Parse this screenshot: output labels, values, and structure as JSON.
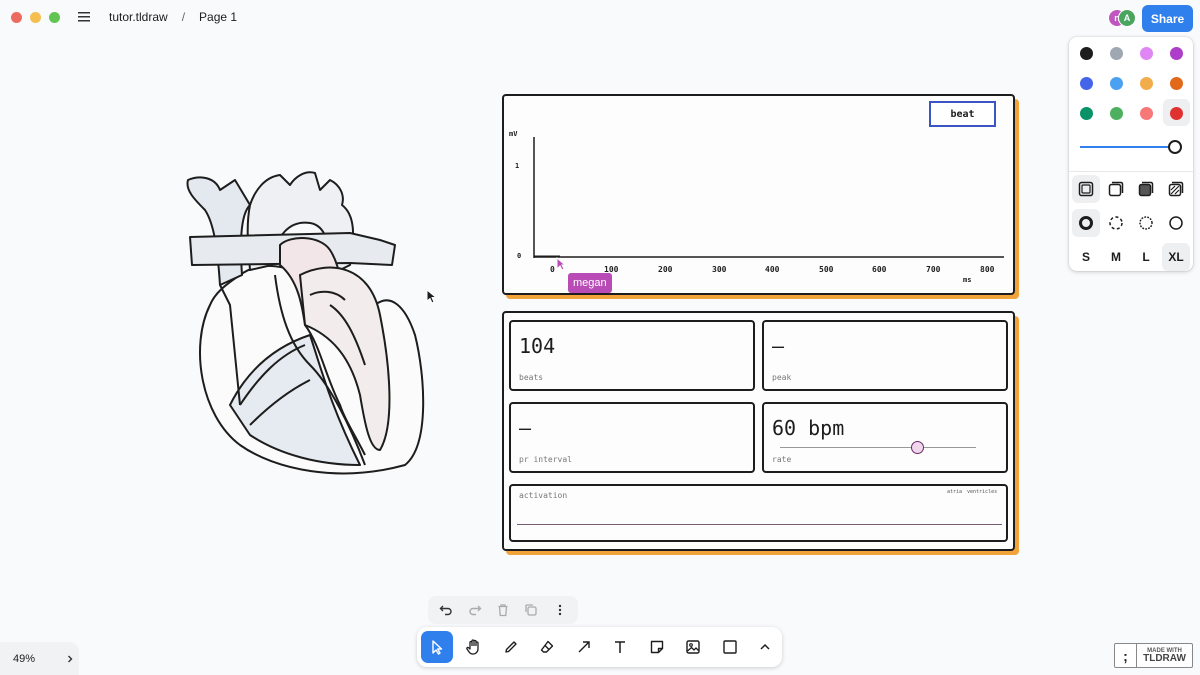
{
  "window": {
    "colors": {
      "close": "#ed6a5e",
      "minimize": "#f5bf4f",
      "maximize": "#61c554"
    }
  },
  "header": {
    "app_file": "tutor.tldraw",
    "separator": "/",
    "page": "Page 1",
    "share_label": "Share",
    "avatars": [
      {
        "initial": "n",
        "color": "#c056bf"
      },
      {
        "initial": "A",
        "color": "#4aa55f"
      }
    ]
  },
  "style_panel": {
    "colors": [
      "#1d1d1d",
      "#9fa8b2",
      "#e085f4",
      "#ae3ec9",
      "#4465e9",
      "#4ba1f1",
      "#f1ac4b",
      "#e16919",
      "#099268",
      "#4cb05e",
      "#f87777",
      "#e03131"
    ],
    "selected_color": "#e03131",
    "opacity": 1.0,
    "fill_options": [
      "none",
      "semi",
      "solid",
      "pattern"
    ],
    "dash_options": [
      "draw",
      "dashed",
      "dotted",
      "solid"
    ],
    "sizes": [
      "S",
      "M",
      "L",
      "XL"
    ],
    "selected_size": "XL"
  },
  "chart_card": {
    "beat_button": "beat",
    "y_unit": "mV",
    "y_ticks": [
      "1",
      "0"
    ],
    "x_ticks": [
      "0",
      "100",
      "200",
      "300",
      "400",
      "500",
      "600",
      "700",
      "800"
    ],
    "x_unit": "ms"
  },
  "collaborator": {
    "name": "megan",
    "color": "#b84bb6"
  },
  "stats": {
    "beats": {
      "value": "104",
      "label": "beats"
    },
    "peak": {
      "value": "—",
      "label": "peak"
    },
    "pr_interval": {
      "value": "—",
      "label": "pr interval"
    },
    "rate": {
      "value": "60 bpm",
      "label": "rate",
      "slider_fraction": 0.7
    },
    "activation": {
      "label": "activation",
      "legend": [
        "atria",
        "ventricles"
      ]
    }
  },
  "toolbar": {
    "actions": [
      "undo-icon",
      "redo-icon",
      "delete-icon",
      "duplicate-icon",
      "more-icon"
    ],
    "tools": [
      "select-icon",
      "hand-icon",
      "draw-icon",
      "eraser-icon",
      "arrow-icon",
      "text-icon",
      "note-icon",
      "image-icon",
      "rectangle-icon",
      "more-tools-icon"
    ],
    "active_tool": "select-icon"
  },
  "zoom": {
    "level": "49%"
  },
  "watermark": {
    "line1": "MADE WITH",
    "line2": "TLDRAW",
    "logo_glyph": ";"
  },
  "theme": {
    "accent": "#2f80ed",
    "card_shadow": "#f2a43a",
    "beat_border": "#3b55c7"
  }
}
